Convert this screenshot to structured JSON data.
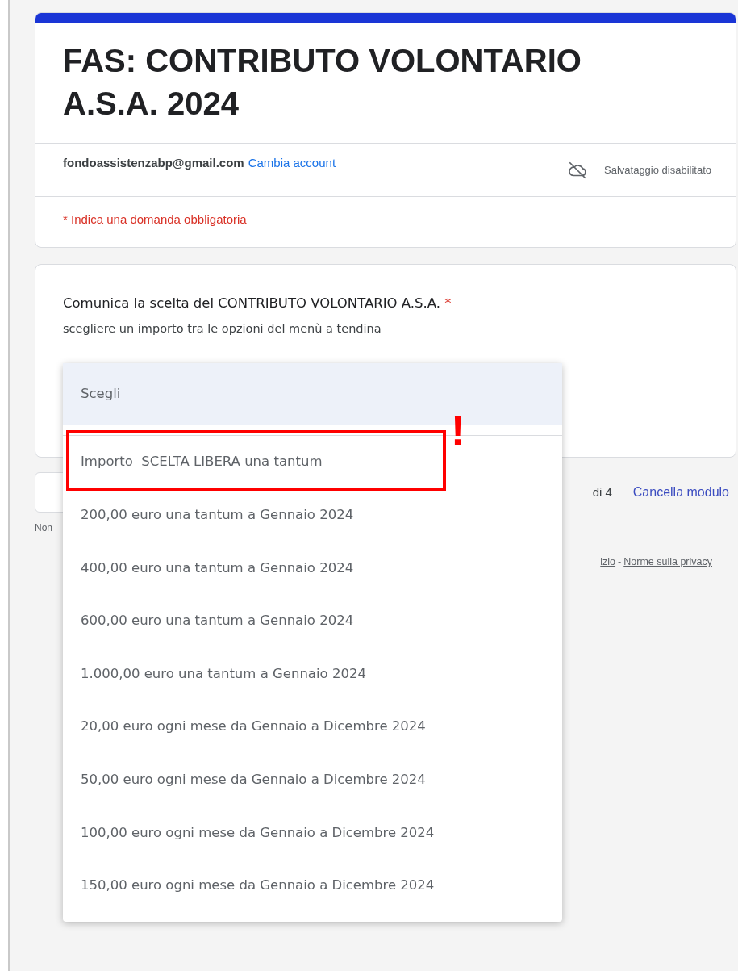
{
  "header": {
    "title": "FAS: CONTRIBUTO VOLONTARIO A.S.A. 2024",
    "email": "fondoassistenzabp@gmail.com",
    "switch_account": "Cambia account",
    "save_status": "Salvataggio disabilitato",
    "required_note": "* Indica una domanda obbligatoria"
  },
  "question": {
    "title": "Comunica la scelta del CONTRIBUTO VOLONTARIO A.S.A.",
    "required_mark": "*",
    "description": "scegliere un importo tra le opzioni del menù a tendina"
  },
  "dropdown": {
    "options": [
      {
        "label": "Scegli",
        "selected": true
      },
      {
        "label": "Importo  SCELTA LIBERA una tantum",
        "selected": false
      },
      {
        "label": "200,00 euro una tantum a Gennaio 2024",
        "selected": false
      },
      {
        "label": "400,00 euro una tantum a Gennaio 2024",
        "selected": false
      },
      {
        "label": "600,00 euro una tantum a Gennaio 2024",
        "selected": false
      },
      {
        "label": "1.000,00 euro una tantum a Gennaio 2024",
        "selected": false
      },
      {
        "label": "20,00 euro ogni mese da Gennaio a Dicembre 2024",
        "selected": false
      },
      {
        "label": "50,00 euro ogni mese da Gennaio a Dicembre 2024",
        "selected": false
      },
      {
        "label": "100,00 euro ogni mese da Gennaio a Dicembre 2024",
        "selected": false
      },
      {
        "label": "150,00 euro ogni mese da Gennaio a Dicembre 2024",
        "selected": false
      }
    ]
  },
  "annotation": {
    "mark": "!"
  },
  "bottom": {
    "page_indicator": "di 4",
    "clear_form": "Cancella modulo",
    "note": "Non",
    "footer_fragment": "izio",
    "footer_separator": "-",
    "privacy_link": "Norme sulla privacy"
  }
}
